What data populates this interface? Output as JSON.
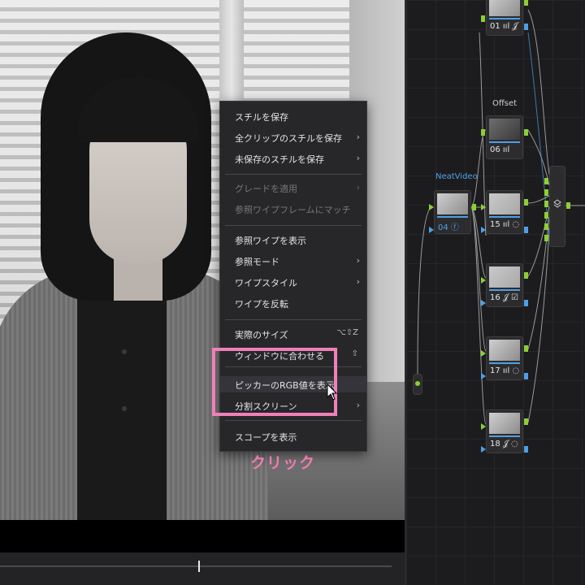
{
  "context_menu": {
    "items": [
      {
        "label": "スチルを保存",
        "submenu": false,
        "enabled": true
      },
      {
        "label": "全クリップのスチルを保存",
        "submenu": true,
        "enabled": true
      },
      {
        "label": "未保存のスチルを保存",
        "submenu": true,
        "enabled": true
      },
      {
        "label": "グレードを適用",
        "submenu": true,
        "enabled": false
      },
      {
        "label": "参照ワイプフレームにマッチ",
        "submenu": false,
        "enabled": false
      },
      {
        "label": "参照ワイプを表示",
        "submenu": false,
        "enabled": true
      },
      {
        "label": "参照モード",
        "submenu": true,
        "enabled": true
      },
      {
        "label": "ワイプスタイル",
        "submenu": true,
        "enabled": true
      },
      {
        "label": "ワイプを反転",
        "submenu": false,
        "enabled": true
      },
      {
        "label": "実際のサイズ",
        "shortcut": "⌥⇧Z",
        "enabled": true
      },
      {
        "label": "ウィンドウに合わせる",
        "shortcut": "⇧",
        "enabled": true
      },
      {
        "label": "ピッカーのRGB値を表示",
        "submenu": false,
        "enabled": true,
        "highlighted": true
      },
      {
        "label": "分割スクリーン",
        "submenu": true,
        "enabled": true
      },
      {
        "label": "スコープを表示",
        "submenu": false,
        "enabled": true
      }
    ],
    "submenu_glyph": "›"
  },
  "annotation": {
    "caption": "クリック",
    "highlight_color": "#f080b8"
  },
  "node_graph": {
    "group_labels": {
      "offset": "Offset",
      "neatvideo": "NeatVideo"
    },
    "nodes": [
      {
        "id": "01",
        "label": "01 ııl 𝒥"
      },
      {
        "id": "06",
        "label": "06 ııl"
      },
      {
        "id": "04",
        "label": "04 ⓕ"
      },
      {
        "id": "15",
        "label": "15 ııl ◌"
      },
      {
        "id": "16",
        "label": "16 𝒥 ☑"
      },
      {
        "id": "17",
        "label": "17 ııl ◌"
      },
      {
        "id": "18",
        "label": "18 𝒥 ◌"
      }
    ],
    "layer_mixer_icon": "layers-icon",
    "colors": {
      "input_port": "#8ccf34",
      "key_port": "#4ea0e6"
    }
  },
  "colors": {
    "menu_bg": "#27272a",
    "accent_blue": "#4ea0e6",
    "annotation_pink": "#ef7ab0"
  }
}
